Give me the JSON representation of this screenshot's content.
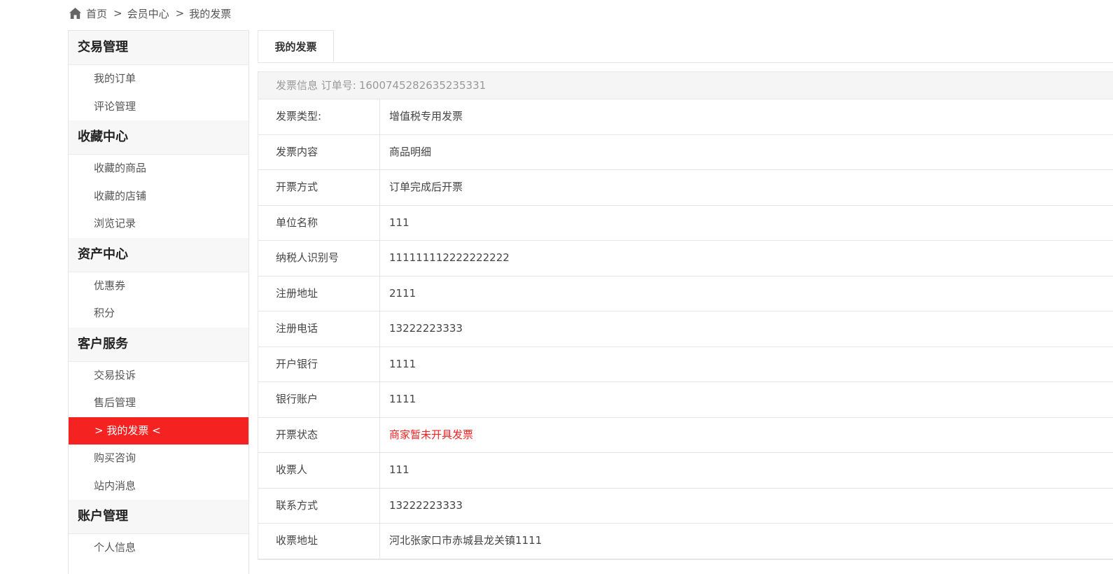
{
  "breadcrumb": {
    "items": [
      "首页",
      "会员中心",
      "我的发票"
    ],
    "separator": ">"
  },
  "sidebar": {
    "groups": [
      {
        "title": "交易管理",
        "items": [
          "我的订单",
          "评论管理"
        ]
      },
      {
        "title": "收藏中心",
        "items": [
          "收藏的商品",
          "收藏的店铺",
          "浏览记录"
        ]
      },
      {
        "title": "资产中心",
        "items": [
          "优惠券",
          "积分"
        ]
      },
      {
        "title": "客户服务",
        "items": [
          "交易投诉",
          "售后管理",
          "> 我的发票 <",
          "购买咨询",
          "站内消息"
        ]
      },
      {
        "title": "账户管理",
        "items": [
          "个人信息"
        ]
      }
    ],
    "active_color": "#f52222"
  },
  "main": {
    "tab_label": "我的发票",
    "info_header": {
      "label": "发票信息 订单号:",
      "order_no": "1600745282635235331"
    },
    "rows": [
      {
        "label": "发票类型:",
        "value": "增值税专用发票"
      },
      {
        "label": "发票内容",
        "value": "商品明细"
      },
      {
        "label": "开票方式",
        "value": "订单完成后开票"
      },
      {
        "label": "单位名称",
        "value": "111"
      },
      {
        "label": "纳税人识别号",
        "value": "111111112222222222"
      },
      {
        "label": "注册地址",
        "value": "2111"
      },
      {
        "label": "注册电话",
        "value": "13222223333"
      },
      {
        "label": "开户银行",
        "value": "1111"
      },
      {
        "label": "银行账户",
        "value": "1111"
      },
      {
        "label": "开票状态",
        "value": "商家暂未开具发票"
      },
      {
        "label": "收票人",
        "value": "111"
      },
      {
        "label": "联系方式",
        "value": "13222223333"
      },
      {
        "label": "收票地址",
        "value": "河北张家口市赤城县龙关镇1111"
      }
    ],
    "status_color": "#f52222"
  }
}
